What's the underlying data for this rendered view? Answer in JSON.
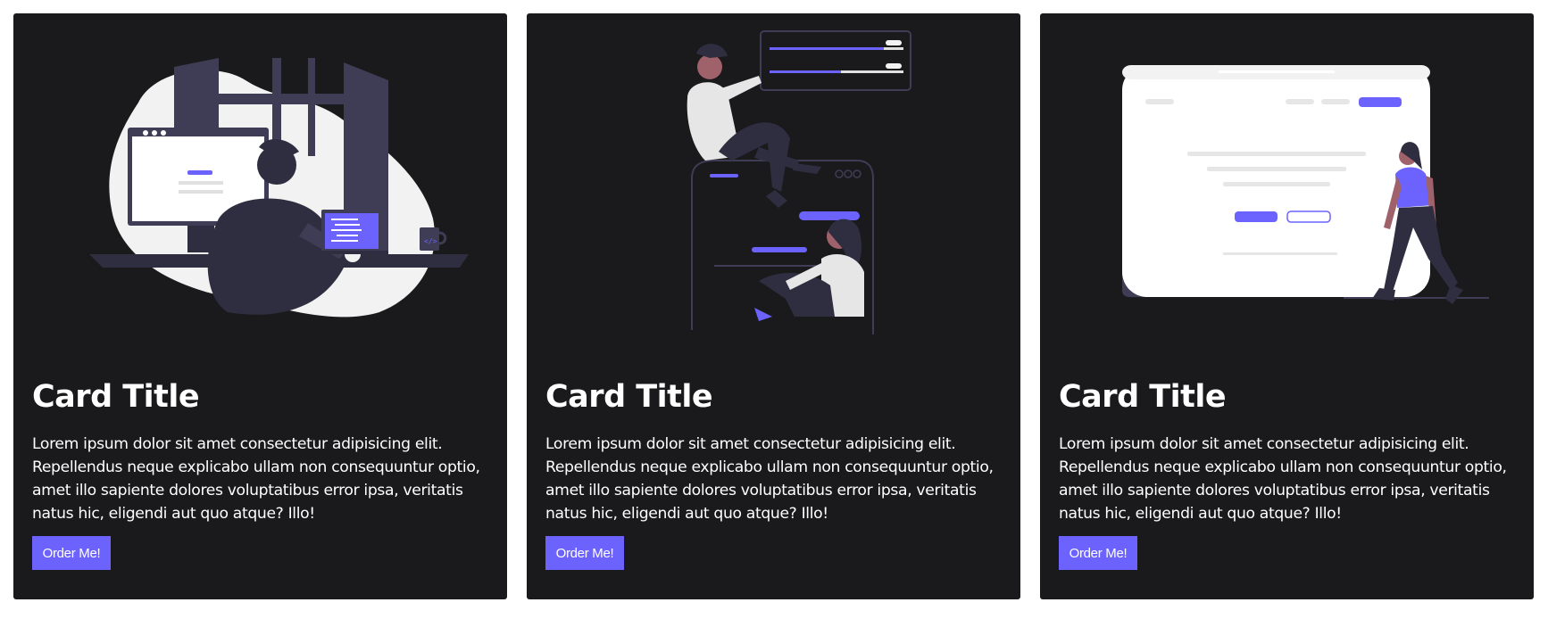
{
  "colors": {
    "card_bg": "#1a191b",
    "accent": "#6c63ff",
    "text": "#ffffff",
    "illustration_light": "#f2f2f2",
    "illustration_dark": "#3f3d56"
  },
  "cards": [
    {
      "illustration": "developer-at-desk-illustration",
      "title": "Card Title",
      "text": "Lorem ipsum dolor sit amet consectetur adipisicing elit. Repellendus neque explicabo ullam non consequuntur optio, amet illo sapiente dolores voluptatibus error ipsa, veritatis natus hic, eligendi aut quo atque? Illo!",
      "button_label": "Order Me!"
    },
    {
      "illustration": "people-with-phone-illustration",
      "title": "Card Title",
      "text": "Lorem ipsum dolor sit amet consectetur adipisicing elit. Repellendus neque explicabo ullam non consequuntur optio, amet illo sapiente dolores voluptatibus error ipsa, veritatis natus hic, eligendi aut quo atque? Illo!",
      "button_label": "Order Me!"
    },
    {
      "illustration": "woman-walking-by-webpage-illustration",
      "title": "Card Title",
      "text": "Lorem ipsum dolor sit amet consectetur adipisicing elit. Repellendus neque explicabo ullam non consequuntur optio, amet illo sapiente dolores voluptatibus error ipsa, veritatis natus hic, eligendi aut quo atque? Illo!",
      "button_label": "Order Me!"
    }
  ]
}
